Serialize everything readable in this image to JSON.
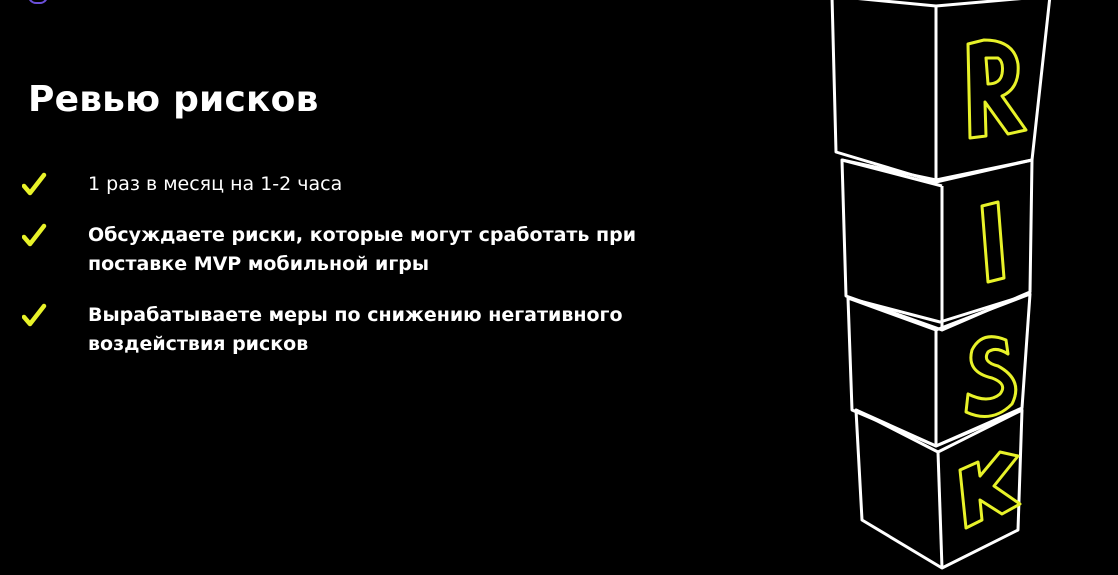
{
  "slide": {
    "title": "Ревью рисков",
    "bullets": [
      {
        "text": "1 раз в месяц на 1-2 часа",
        "weight": "normal"
      },
      {
        "text": "Обсуждаете риски, которые могут сработать при поставке MVP мобильной игры",
        "weight": "bold"
      },
      {
        "text": "Вырабатываете меры по снижению негативного воздействия рисков",
        "weight": "bold"
      }
    ]
  },
  "illustration": {
    "letters": [
      "R",
      "I",
      "S",
      "K"
    ],
    "letter_color": "#e8f229",
    "outline_color": "#ffffff"
  },
  "colors": {
    "background": "#000000",
    "text": "#ffffff",
    "check": "#e8f229",
    "corner_accent": "#6b4fd8"
  },
  "icons": {
    "bullet": "checkmark-icon",
    "corner": "brand-mark-icon"
  }
}
